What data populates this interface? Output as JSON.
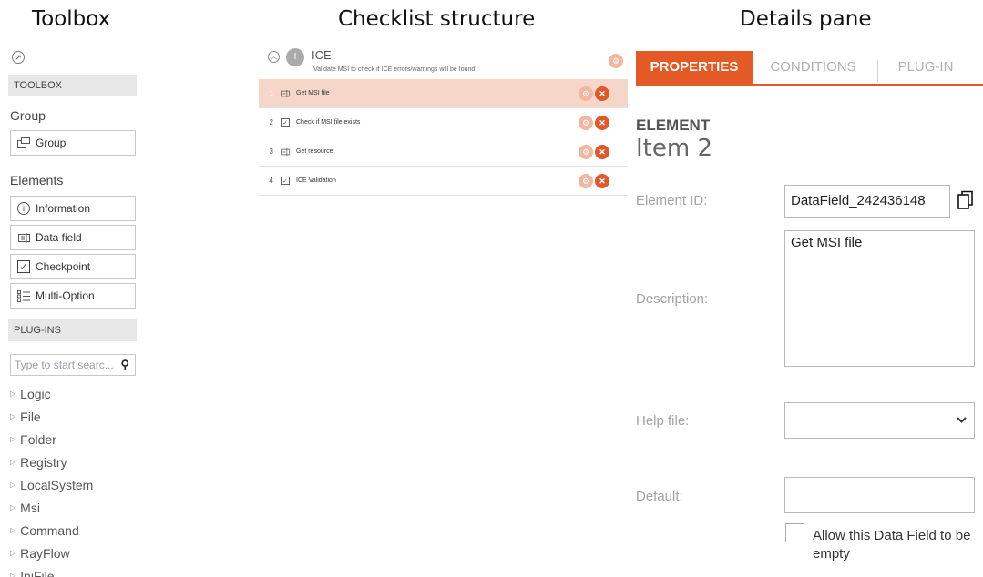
{
  "headings": {
    "toolbox": "Toolbox",
    "checklist": "Checklist structure",
    "details": "Details pane"
  },
  "toolbox": {
    "pin_icon": "arrow-pin-icon",
    "band_toolbox": "TOOLBOX",
    "group_section": "Group",
    "group_button": "Group",
    "elements_section": "Elements",
    "element_buttons": [
      {
        "label": "Information",
        "icon": "info-icon"
      },
      {
        "label": "Data field",
        "icon": "data-field-icon"
      },
      {
        "label": "Checkpoint",
        "icon": "checkbox-icon"
      },
      {
        "label": "Multi-Option",
        "icon": "multi-option-icon"
      }
    ],
    "band_plugins": "PLUG-INS",
    "search_placeholder": "Type to start searc...",
    "plugins": [
      "Logic",
      "File",
      "Folder",
      "Registry",
      "LocalSystem",
      "Msi",
      "Command",
      "RayFlow",
      "IniFile"
    ]
  },
  "checklist": {
    "group_number": "I",
    "group_title": "ICE",
    "group_subtitle": "Validate MSI to check if ICE errors/warnings will be found",
    "rows": [
      {
        "n": "1",
        "label": "Get MSI file",
        "icon": "data-field-icon",
        "selected": true
      },
      {
        "n": "2",
        "label": "Check if MSI file exists",
        "icon": "checkbox-icon",
        "selected": false
      },
      {
        "n": "3",
        "label": "Get resource",
        "icon": "data-field-icon",
        "selected": false
      },
      {
        "n": "4",
        "label": "ICE Validation",
        "icon": "checkbox-icon",
        "selected": false
      }
    ]
  },
  "details": {
    "tabs": [
      "PROPERTIES",
      "CONDITIONS",
      "PLUG-IN"
    ],
    "active_tab": "PROPERTIES",
    "element_label": "ELEMENT",
    "element_item": "Item  2",
    "element_id_label": "Element ID:",
    "element_id_value": "DataField_242436148",
    "description_label": "Description:",
    "description_value": "Get MSI file",
    "help_file_label": "Help file:",
    "help_file_value": "",
    "default_label": "Default:",
    "default_value": "",
    "allow_empty_label": "Allow this Data Field to be empty"
  },
  "colors": {
    "accent": "#e35a27",
    "selected_row": "#f7d6ca",
    "tool_action": "#f1b79f",
    "band": "#e7e7e7"
  }
}
